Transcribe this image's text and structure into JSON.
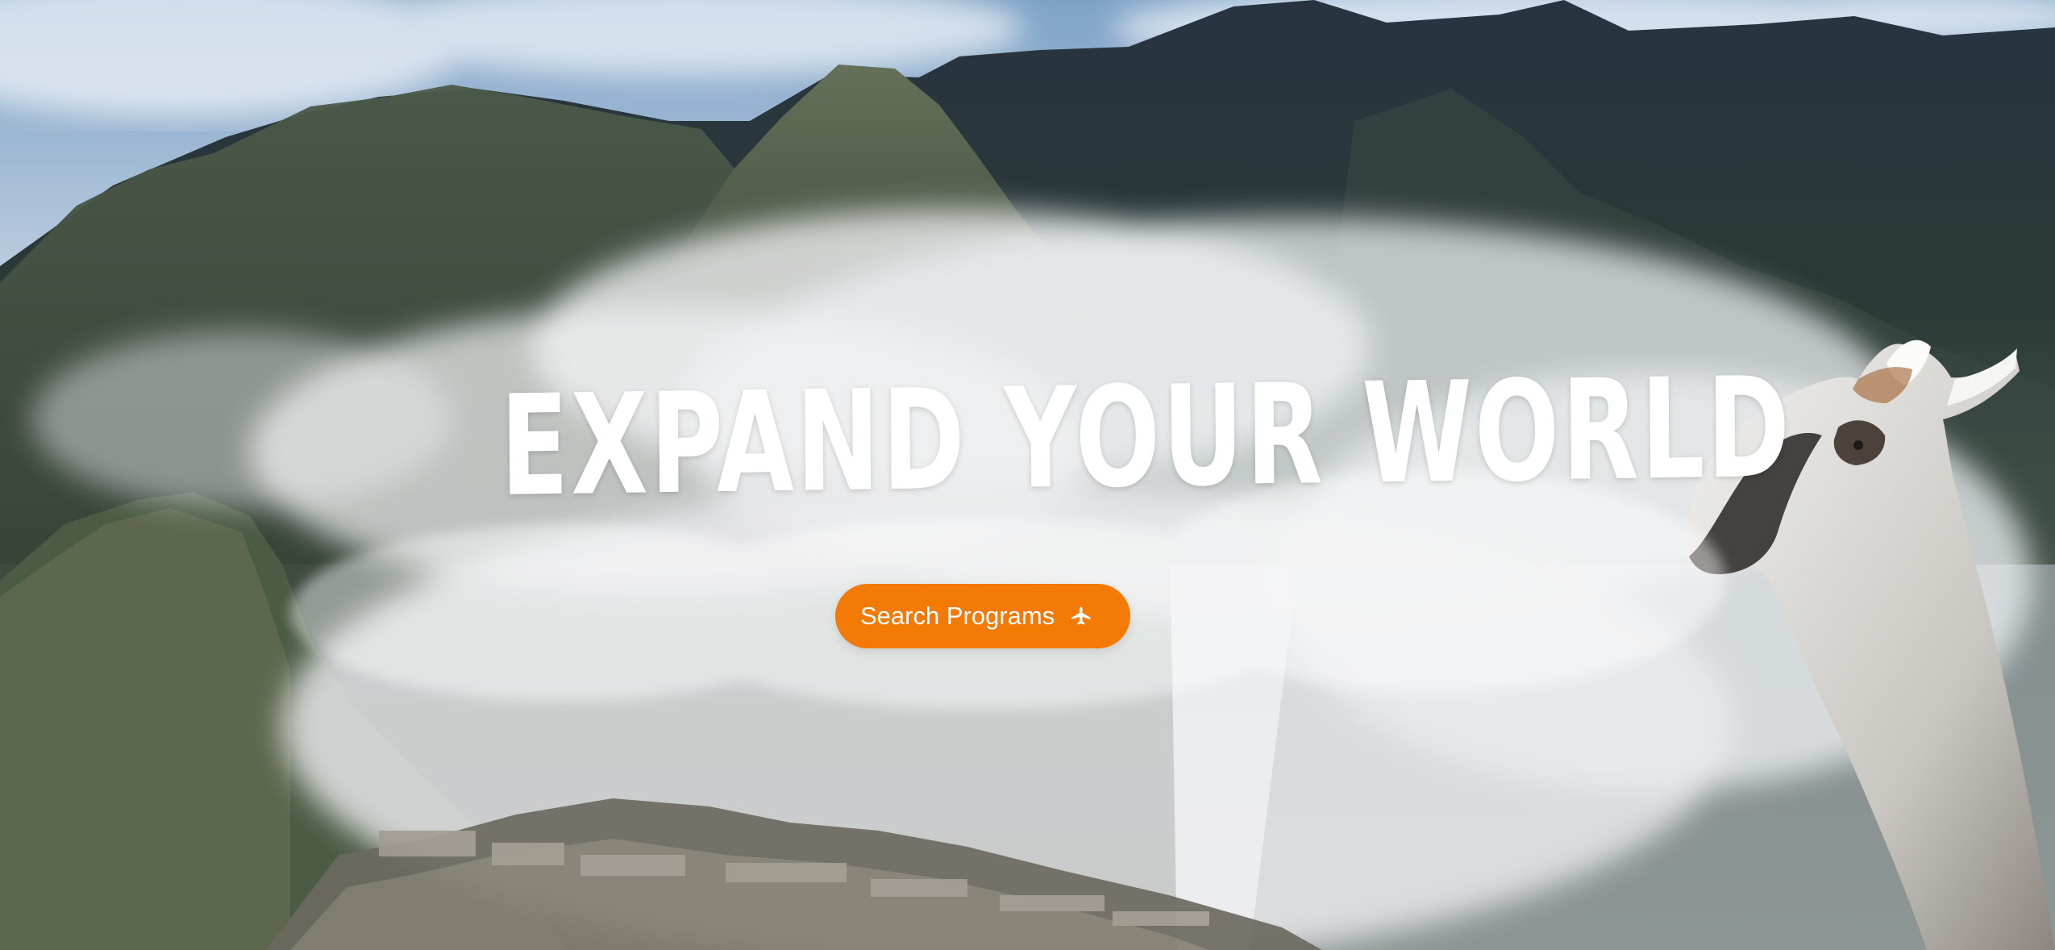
{
  "hero": {
    "title": "EXPAND YOUR WORLD",
    "cta_label": "Search Programs",
    "cta_icon": "airplane-icon"
  },
  "colors": {
    "cta_background": "#f27a05",
    "hero_text": "#ffffff"
  }
}
